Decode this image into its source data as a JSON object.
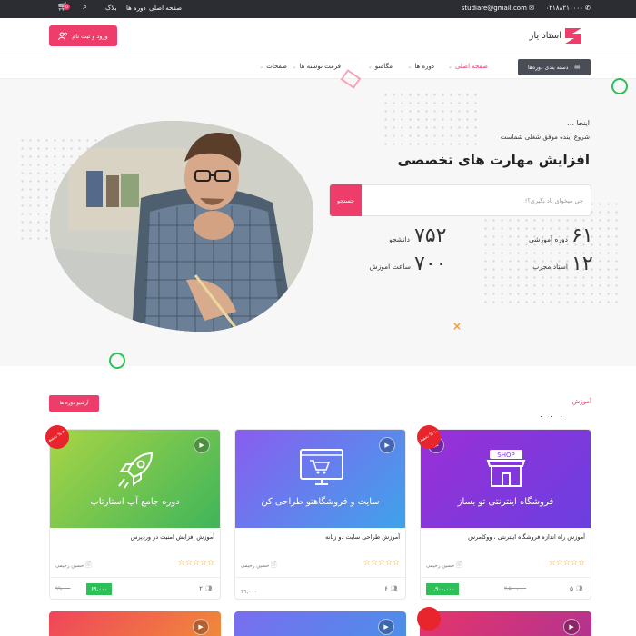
{
  "topbar": {
    "phone": "۰۲۱۸۸۲۱۰۰۰۰",
    "email": "studiare@gmail.com",
    "links": [
      "صفحه اصلی",
      "دوره ها",
      "بلاگ"
    ],
    "cart_badge": "0"
  },
  "header": {
    "logo_text": "استاد یار",
    "login_label": "ورود و ثبت نام"
  },
  "nav": {
    "category_label": "دسته بندی دوره‌ها",
    "items": [
      "صفحه اصلی",
      "دوره ها",
      "مگامنو",
      "فرمت نوشته ها",
      "صفحات"
    ]
  },
  "hero": {
    "kicker": "اینجا ...",
    "subtitle": "شروع آینده موفق شغلی شماست",
    "title": "افزایش مهارت های تخصصی",
    "search_placeholder": "چی میخوای یاد بگیری؟!",
    "search_button": "جستجو",
    "stats": [
      {
        "num": "۶۱",
        "label": "دوره آموزشی"
      },
      {
        "num": "۷۵۲",
        "label": "دانشجو"
      },
      {
        "num": "۱۲",
        "label": "استاد مجرب"
      },
      {
        "num": "۷۰۰",
        "label": "ساعت آموزش"
      }
    ]
  },
  "section": {
    "label": "آموزش",
    "dots": ". . .",
    "archive_button": "آرشیو دوره ها"
  },
  "cards": [
    {
      "image_title": "فروشگاه اینترنتی تو بساز",
      "name": "آموزش راه اندازه فروشگاه اینترنتی ، ووکامرس",
      "teacher": "حسین رحیمی",
      "count": "۵",
      "price": "۱,۹۰۰,۰۰۰",
      "old_price": "۲,۵۰۰,۰۰۰",
      "badge": "۱۰ % تخفیف",
      "rating": "☆☆☆☆☆"
    },
    {
      "image_title": "سایت و فروشگاهتو طراحی کن",
      "name": "آموزش طراحی سایت دو زبانه",
      "teacher": "حسین رحیمی",
      "count": "۶",
      "price": "۴۹,۰۰۰",
      "old_price": "",
      "badge": "",
      "rating": "☆☆☆☆☆"
    },
    {
      "image_title": "دوره جامع آپ استارتاپ",
      "name": "آموزش افزایش امنیت در وردپرس",
      "teacher": "حسین رحیمی",
      "count": "۲",
      "price": "۶۹,۰۰۰",
      "old_price": "۹۹,۰۰۰",
      "badge": "۳۰ % تخفیف",
      "rating": "☆☆☆☆☆"
    }
  ],
  "colors": {
    "accent": "#ef3d6b",
    "green": "#2ec058",
    "dark": "#2b2d33"
  }
}
